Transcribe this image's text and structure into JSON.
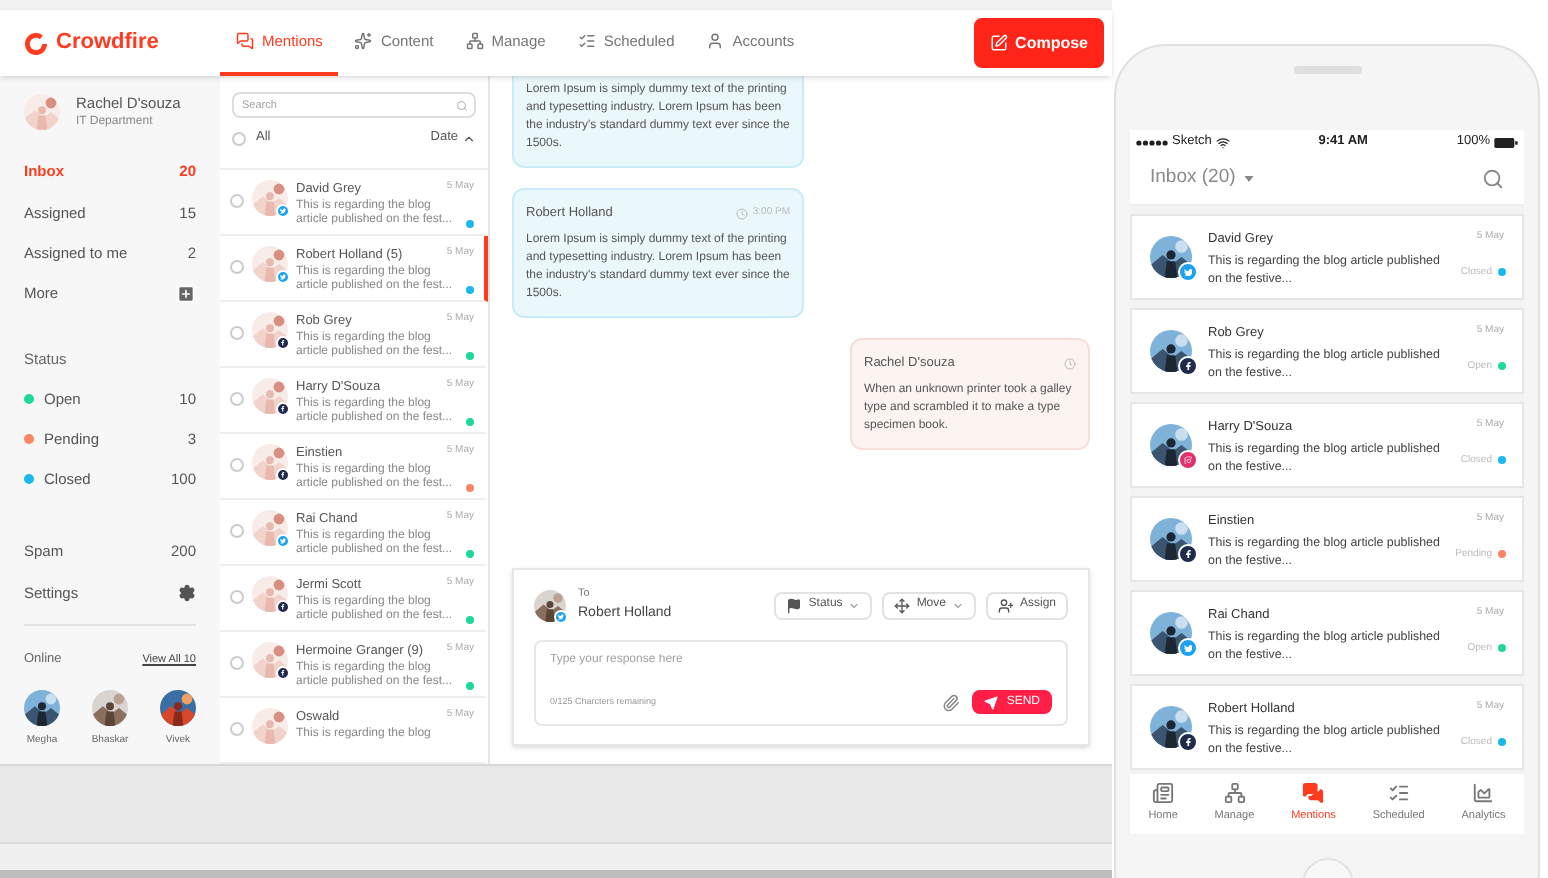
{
  "app": {
    "logo": "Crowdfire",
    "compose": "Compose",
    "nav": [
      {
        "label": "Mentions",
        "kind": "mentions",
        "selected": true
      },
      {
        "label": "Content",
        "kind": "content",
        "selected": false
      },
      {
        "label": "Manage",
        "kind": "manage",
        "selected": false
      },
      {
        "label": "Scheduled",
        "kind": "scheduled",
        "selected": false
      },
      {
        "label": "Accounts",
        "kind": "accounts",
        "selected": false
      }
    ]
  },
  "user": {
    "name": "Rachel D'souza",
    "department": "IT Department"
  },
  "folders": [
    {
      "label": "Inbox",
      "count": "20",
      "selected": true
    },
    {
      "label": "Assigned",
      "count": "15",
      "selected": false
    },
    {
      "label": "Assigned to me",
      "count": "2",
      "selected": false
    }
  ],
  "more": "More",
  "status_heading": "Status",
  "statuses": [
    {
      "label": "Open",
      "count": "10",
      "color": "#1ed79a"
    },
    {
      "label": "Pending",
      "count": "3",
      "color": "#fb8466"
    },
    {
      "label": "Closed",
      "count": "100",
      "color": "#1bb8ee"
    }
  ],
  "spam": {
    "label": "Spam",
    "count": "200"
  },
  "settings": "Settings",
  "online": {
    "heading": "Online",
    "view_all": "View All 10",
    "people": [
      "Megha",
      "Bhaskar",
      "Vivek"
    ]
  },
  "list": {
    "search_placeholder": "Search",
    "all": "All",
    "all_checked": false,
    "sort": "Date",
    "items": [
      {
        "name": "David Grey",
        "preview": "This is regarding the blog article published on the fest...",
        "date": "5 May",
        "kind": "twitter",
        "color": "#1bb8ee",
        "checked": false,
        "selected": false
      },
      {
        "name": "Robert Holland (5)",
        "preview": "This is regarding the blog article published on the fest...",
        "date": "5 May",
        "kind": "twitter",
        "color": "#1bb8ee",
        "checked": false,
        "selected": true
      },
      {
        "name": "Rob Grey",
        "preview": "This is regarding the blog article published on the fest...",
        "date": "5 May",
        "kind": "facebook",
        "color": "#1ed79a",
        "checked": false,
        "selected": false
      },
      {
        "name": "Harry D'Souza",
        "preview": "This is regarding the blog article published on the fest...",
        "date": "5 May",
        "kind": "facebook",
        "color": "#1ed79a",
        "checked": false,
        "selected": false
      },
      {
        "name": "Einstien",
        "preview": "This is regarding the blog article published on the fest...",
        "date": "5 May",
        "kind": "facebook",
        "color": "#fb8466",
        "checked": false,
        "selected": false
      },
      {
        "name": "Rai Chand",
        "preview": "This is regarding the blog article published on the fest...",
        "date": "5 May",
        "kind": "twitter",
        "color": "#1ed79a",
        "checked": false,
        "selected": false
      },
      {
        "name": "Jermi Scott",
        "preview": "This is regarding the blog article published on the fest...",
        "date": "5 May",
        "kind": "facebook",
        "color": "#1ed79a",
        "checked": false,
        "selected": false
      },
      {
        "name": "Hermoine Granger (9)",
        "preview": "This is regarding the blog article published on the fest...",
        "date": "5 May",
        "kind": "facebook",
        "color": "#1ed79a",
        "checked": false,
        "selected": false
      },
      {
        "name": "Oswald",
        "preview": "This is regarding the blog",
        "date": "5 May",
        "checked": false,
        "selected": false
      }
    ]
  },
  "messages": [
    {
      "kind": "incoming",
      "text": "Lorem Ipsum is simply dummy text of the printing and typesetting industry. Lorem Ipsum has been the industry's standard dummy text ever since the 1500s."
    },
    {
      "kind": "incoming",
      "author": "Robert Holland",
      "time": "3:00 PM",
      "text": "Lorem Ipsum is simply dummy text of the printing and typesetting industry. Lorem Ipsum has been the industry's standard dummy text ever since the 1500s."
    },
    {
      "kind": "outgoing",
      "author": "Rachel D'souza",
      "text": "When an unknown printer took a galley type and scrambled it to make a type specimen book."
    }
  ],
  "reply": {
    "to_label": "To",
    "recipient": "Robert Holland",
    "buttons": [
      {
        "label": "Status",
        "kind": "status"
      },
      {
        "label": "Move",
        "kind": "move"
      },
      {
        "label": "Assign",
        "kind": "assign"
      }
    ],
    "placeholder": "Type your response here",
    "counter": "0/125 Charcters remaining",
    "send": "SEND"
  },
  "phone": {
    "carrier": "Sketch",
    "time": "9:41 AM",
    "battery": "100%",
    "title": "Inbox (20)",
    "items": [
      {
        "name": "David Grey",
        "date": "5 May",
        "text": "This is regarding the blog article published on the festive...",
        "status": "Closed",
        "color": "#1bb8ee",
        "kind": "twitter"
      },
      {
        "name": "Rob Grey",
        "date": "5 May",
        "text": "This is regarding the blog article published on the festive...",
        "status": "Open",
        "color": "#1ed79a",
        "kind": "facebook"
      },
      {
        "name": "Harry D'Souza",
        "date": "5 May",
        "text": "This is regarding the blog article published on the festive...",
        "status": "Closed",
        "color": "#1bb8ee",
        "kind": "instagram"
      },
      {
        "name": "Einstien",
        "date": "5 May",
        "text": "This is regarding the blog article published on the festive...",
        "status": "Pending",
        "color": "#fb8466",
        "kind": "facebook"
      },
      {
        "name": "Rai Chand",
        "date": "5 May",
        "text": "This is regarding the blog article published on the festive...",
        "status": "Open",
        "color": "#1ed79a",
        "kind": "twitter"
      },
      {
        "name": "Robert Holland",
        "date": "5 May",
        "text": "This is regarding the blog article published on the festive...",
        "status": "Closed",
        "color": "#1bb8ee",
        "kind": "facebook"
      }
    ],
    "tabs": [
      {
        "label": "Home",
        "kind": "home",
        "selected": false
      },
      {
        "label": "Manage",
        "kind": "manage",
        "selected": false
      },
      {
        "label": "Mentions",
        "kind": "mentions",
        "selected": true
      },
      {
        "label": "Scheduled",
        "kind": "scheduled",
        "selected": false
      },
      {
        "label": "Analytics",
        "kind": "analytics",
        "selected": false
      }
    ]
  }
}
